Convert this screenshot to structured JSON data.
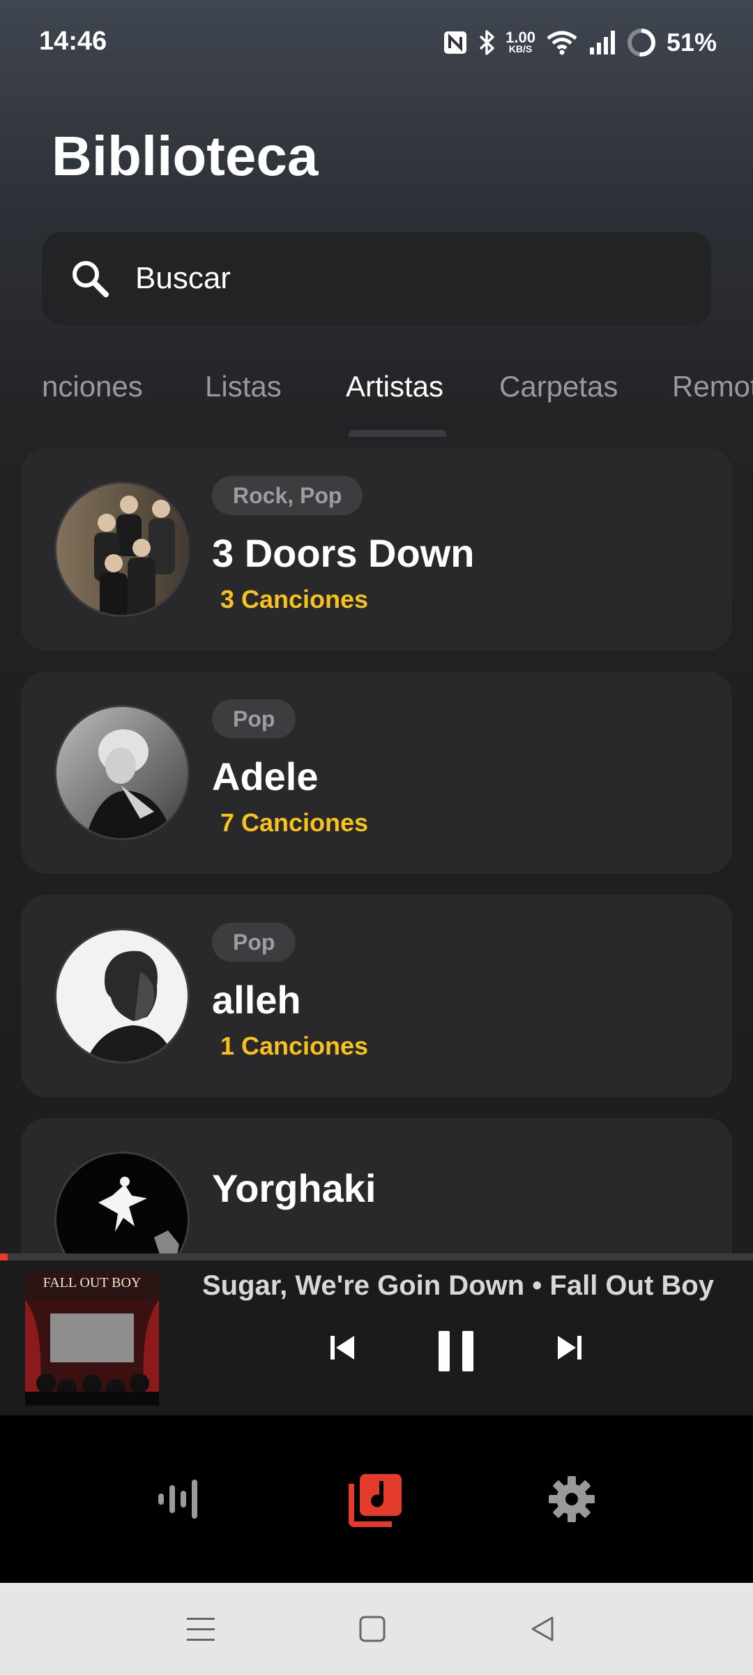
{
  "status_bar": {
    "time": "14:46",
    "speed_value": "1.00",
    "speed_unit": "KB/S",
    "battery": "51%",
    "icons": [
      "nfc-icon",
      "bluetooth-icon",
      "wifi-icon",
      "signal-icon",
      "battery-icon"
    ]
  },
  "header": {
    "title": "Biblioteca"
  },
  "search": {
    "placeholder": "Buscar",
    "icon": "search-icon"
  },
  "tabs": [
    {
      "label": "nciones",
      "active": false
    },
    {
      "label": "Listas",
      "active": false
    },
    {
      "label": "Artistas",
      "active": true
    },
    {
      "label": "Carpetas",
      "active": false
    },
    {
      "label": "Remot",
      "active": false
    }
  ],
  "artists": [
    {
      "genre": "Rock, Pop",
      "name": "3 Doors Down",
      "count": "3 Canciones"
    },
    {
      "genre": "Pop",
      "name": "Adele",
      "count": "7 Canciones"
    },
    {
      "genre": "Pop",
      "name": "alleh",
      "count": "1 Canciones"
    },
    {
      "genre": "",
      "name": "Yorghaki",
      "count": ""
    }
  ],
  "player": {
    "now_playing": "Sugar, We're Goin Down • Fall Out Boy",
    "cover_text": "FALL OUT BOY",
    "progress": 0.01,
    "controls": [
      "previous-icon",
      "pause-icon",
      "next-icon"
    ]
  },
  "bottom_nav": {
    "items": [
      {
        "name": "now-playing",
        "icon": "waveform-icon",
        "active": false
      },
      {
        "name": "library",
        "icon": "music-library-icon",
        "active": true
      },
      {
        "name": "settings",
        "icon": "gear-icon",
        "active": false
      }
    ],
    "accent": "#e53b2c"
  },
  "system_nav": [
    "menu-icon",
    "home-icon",
    "back-icon"
  ],
  "colors": {
    "count_color": "#f6c21b",
    "accent": "#e53b2c"
  }
}
